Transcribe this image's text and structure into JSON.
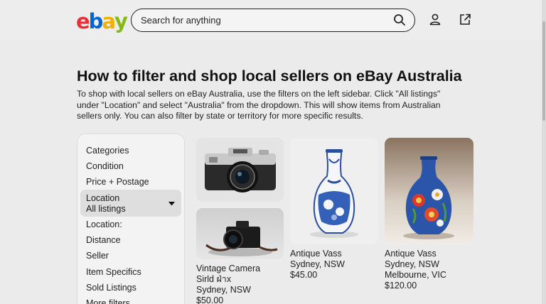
{
  "header": {
    "logo": [
      "e",
      "b",
      "a",
      "y"
    ],
    "logo_colors": [
      "#e53238",
      "#0064d2",
      "#f5af02",
      "#86b817"
    ],
    "search_placeholder": "Search for anything",
    "icons": [
      "search-icon",
      "user-icon",
      "share-icon"
    ]
  },
  "article": {
    "title": "How to filter and shop local sellers on eBay Australia",
    "lines": [
      "To shop with local sellers on eBay Australia, use the filters on the left sidebar. Click \"All listings\"",
      "under \"Location\" and select \"Australia\" from the dropdown. This will show items from Australian",
      "sellers only. You can also filter by state or territory for more specific results."
    ]
  },
  "sidebar": {
    "items": [
      "Categories",
      "Condition",
      "Price + Postage"
    ],
    "location_select": {
      "label": "Location",
      "value": "All listings"
    },
    "items_after": [
      "Location:",
      "Distance",
      "Seller",
      "Item Specifics",
      "Sold Listings",
      "More filters"
    ]
  },
  "listings": [
    {
      "image": "film-camera-silver",
      "lines": []
    },
    {
      "image": "vintage-camera-black",
      "lines": [
        "Vintage Camera",
        "Sirld ฝ่าx",
        "Sydney, NSW",
        "$50.00"
      ]
    },
    {
      "image": "blue-white-vase",
      "lines": [
        "Antique Vass",
        "Sydney, NSW",
        "$45.00"
      ]
    },
    {
      "image": "painted-floral-vase",
      "lines": [
        "Antique Vass",
        "Sydney, NSW",
        "Melbourne, VIC",
        "$120.00"
      ]
    }
  ]
}
